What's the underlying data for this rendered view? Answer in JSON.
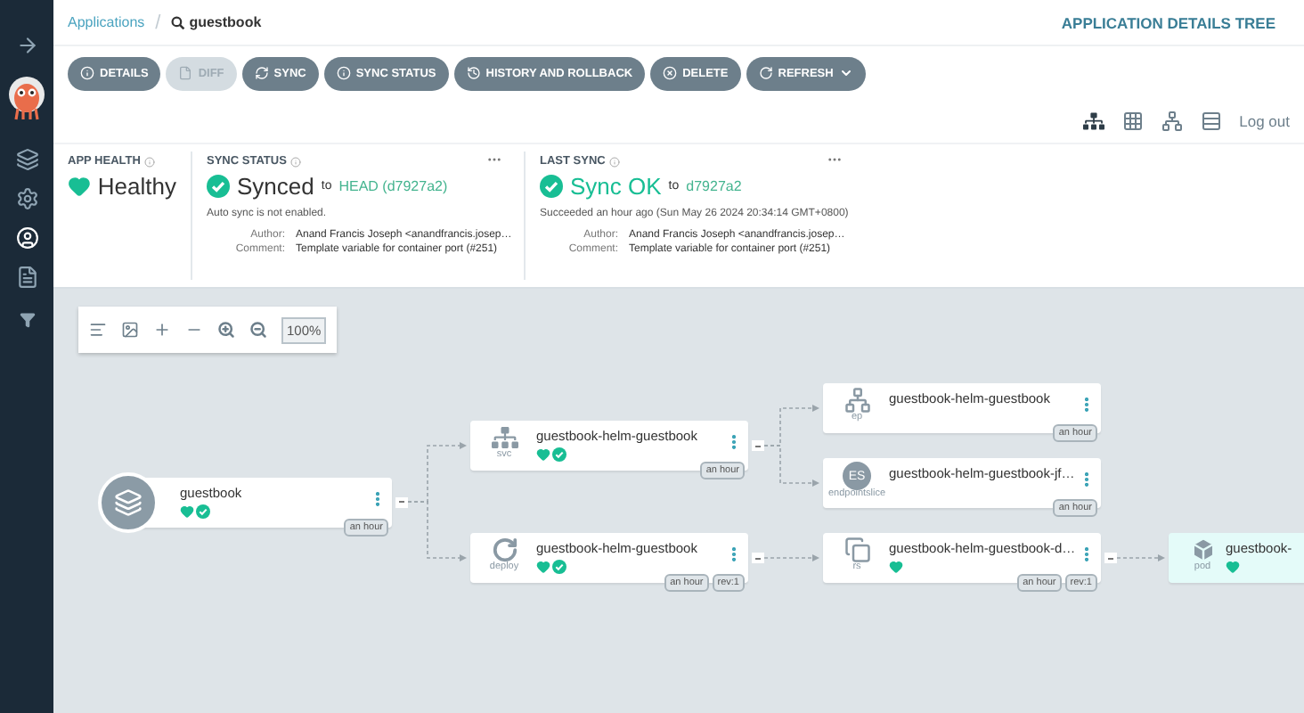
{
  "sidebar": {
    "items": [
      {
        "kind": "expand",
        "selected": false
      },
      {
        "kind": "applications",
        "selected": false
      },
      {
        "kind": "settings",
        "selected": false
      },
      {
        "kind": "user",
        "selected": true
      },
      {
        "kind": "docs",
        "selected": false
      },
      {
        "kind": "filter",
        "selected": false
      }
    ]
  },
  "breadcrumb": {
    "parent": "Applications",
    "separator": "/",
    "current": "guestbook"
  },
  "page_title": "APPLICATION DETAILS TREE",
  "actions": [
    {
      "label": "DETAILS",
      "kind": "details",
      "disabled": false,
      "dropdown": false
    },
    {
      "label": "DIFF",
      "kind": "diff",
      "disabled": true,
      "dropdown": false
    },
    {
      "label": "SYNC",
      "kind": "sync",
      "disabled": false,
      "dropdown": false
    },
    {
      "label": "SYNC STATUS",
      "kind": "status",
      "disabled": false,
      "dropdown": false
    },
    {
      "label": "HISTORY AND ROLLBACK",
      "kind": "history",
      "disabled": false,
      "dropdown": false
    },
    {
      "label": "DELETE",
      "kind": "delete",
      "disabled": false,
      "dropdown": false
    },
    {
      "label": "REFRESH",
      "kind": "refresh",
      "disabled": false,
      "dropdown": true
    }
  ],
  "view_modes": [
    {
      "kind": "tree",
      "selected": true
    },
    {
      "kind": "pods",
      "selected": false
    },
    {
      "kind": "network",
      "selected": false
    },
    {
      "kind": "list",
      "selected": false
    }
  ],
  "logout": "Log out",
  "app_health": {
    "title": "APP HEALTH",
    "status": "Healthy"
  },
  "sync_status": {
    "title": "SYNC STATUS",
    "status": "Synced",
    "to": "to",
    "revision": "HEAD (d7927a2)",
    "note": "Auto sync is not enabled.",
    "details": [
      {
        "label": "Author:",
        "value": "Anand Francis Joseph <anandfrancis.josep…"
      },
      {
        "label": "Comment:",
        "value": "Template variable for container port (#251)"
      }
    ]
  },
  "last_sync": {
    "title": "LAST SYNC",
    "status": "Sync OK",
    "to": "to",
    "revision": "d7927a2",
    "note": "Succeeded an hour ago (Sun May 26 2024 20:34:14 GMT+0800)",
    "details": [
      {
        "label": "Author:",
        "value": "Anand Francis Joseph <anandfrancis.josep…"
      },
      {
        "label": "Comment:",
        "value": "Template variable for container port (#251)"
      }
    ]
  },
  "graph_toolbar": {
    "zoom": "100%"
  },
  "tree": {
    "kind": "app",
    "name": "guestbook",
    "healthy": true,
    "synced": true,
    "highlighted": false,
    "badges": [
      "an hour"
    ],
    "children": [
      {
        "kind": "svc",
        "type_label": "svc",
        "name": "guestbook-helm-guestbook",
        "healthy": true,
        "synced": true,
        "highlighted": false,
        "badges": [
          "an hour"
        ],
        "children": [
          {
            "kind": "ep",
            "type_label": "ep",
            "name": "guestbook-helm-guestbook",
            "healthy": false,
            "synced": false,
            "highlighted": false,
            "badges": [
              "an hour"
            ]
          },
          {
            "kind": "endpointslice",
            "type_label": "endpointslice",
            "icon_text": "ES",
            "name": "guestbook-helm-guestbook-jf…",
            "healthy": false,
            "synced": false,
            "highlighted": false,
            "badges": [
              "an hour"
            ]
          }
        ]
      },
      {
        "kind": "deploy",
        "type_label": "deploy",
        "name": "guestbook-helm-guestbook",
        "healthy": true,
        "synced": true,
        "highlighted": false,
        "badges": [
          "an hour",
          "rev:1"
        ],
        "children": [
          {
            "kind": "rs",
            "type_label": "rs",
            "name": "guestbook-helm-guestbook-d…",
            "healthy": true,
            "synced": false,
            "highlighted": false,
            "badges": [
              "an hour",
              "rev:1"
            ],
            "children": [
              {
                "kind": "pod",
                "type_label": "pod",
                "name": "guestbook-",
                "healthy": true,
                "synced": false,
                "highlighted": true
              }
            ]
          }
        ]
      }
    ]
  }
}
